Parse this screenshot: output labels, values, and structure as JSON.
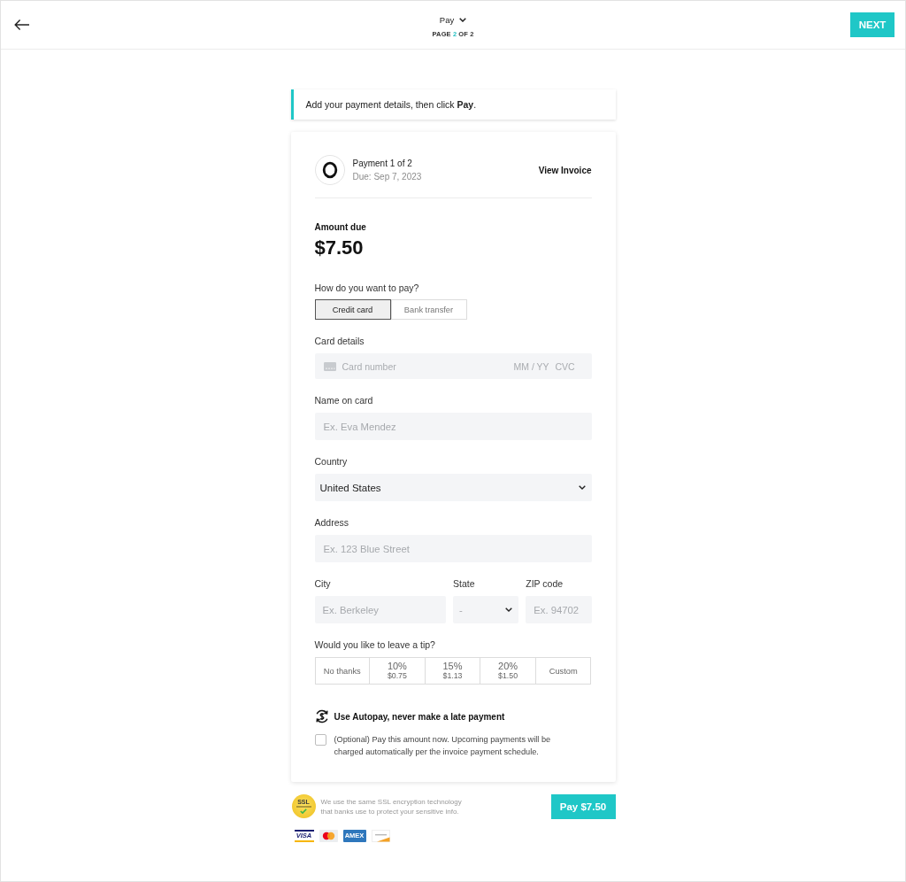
{
  "top_bar": {
    "title": "Pay",
    "page_indicator": {
      "before": "PAGE",
      "current": "2",
      "after": "OF 2"
    },
    "next_button": "NEXT"
  },
  "notice": {
    "text": "Add your payment details, then click **Pay**."
  },
  "payment_header": {
    "title": "Payment 1 of 2",
    "due": "Due: Sep 7, 2023",
    "link": "View Invoice"
  },
  "amount": {
    "label": "Amount due",
    "value": "$7.50"
  },
  "payment_method": {
    "label": "How do you want to pay?",
    "options": [
      {
        "label": "Credit card",
        "selected": true
      },
      {
        "label": "Bank transfer",
        "selected": false
      }
    ]
  },
  "card_details": {
    "label": "Card details",
    "number_placeholder": "Card number",
    "expiry_placeholder": "MM / YY",
    "cvc_placeholder": "CVC"
  },
  "form_fields": [
    {
      "kind": "text",
      "label": "Name on card",
      "placeholder": "Ex. Eva Mendez"
    },
    {
      "kind": "select",
      "label": "Country",
      "value": "United States"
    },
    {
      "kind": "text",
      "label": "Address",
      "placeholder": "Ex. 123 Blue Street"
    }
  ],
  "location_fields": [
    {
      "kind": "text",
      "label": "City",
      "placeholder": "Ex. Berkeley"
    },
    {
      "kind": "select",
      "label": "State",
      "placeholder": "-"
    },
    {
      "kind": "text",
      "label": "ZIP code",
      "placeholder": "Ex. 94702"
    }
  ],
  "tip": {
    "label": "Would you like to leave a tip?",
    "options": [
      {
        "label": "No thanks",
        "selected": false
      },
      {
        "label": "10%",
        "amount": "$0.75",
        "selected": false
      },
      {
        "label": "15%",
        "amount": "$1.13",
        "selected": false
      },
      {
        "label": "20%",
        "amount": "$1.50",
        "selected": false
      },
      {
        "label": "Custom",
        "selected": false
      }
    ]
  },
  "autopay": {
    "title": "Use Autopay, never make a late payment",
    "checked": false,
    "text": "(Optional) Pay this amount now. Upcoming payments will be charged automatically per the invoice payment schedule."
  },
  "footer": {
    "ssl_badge": {
      "title": "SSL"
    },
    "security_note": "We use the same SSL encryption technology that banks use to protect your sensitive info.",
    "pay_button": "Pay $7.50",
    "card_brands": [
      {
        "kind": "visa",
        "label": "VISA"
      },
      {
        "kind": "mastercard"
      },
      {
        "kind": "amex",
        "label": "AMEX"
      },
      {
        "kind": "discover"
      }
    ]
  }
}
